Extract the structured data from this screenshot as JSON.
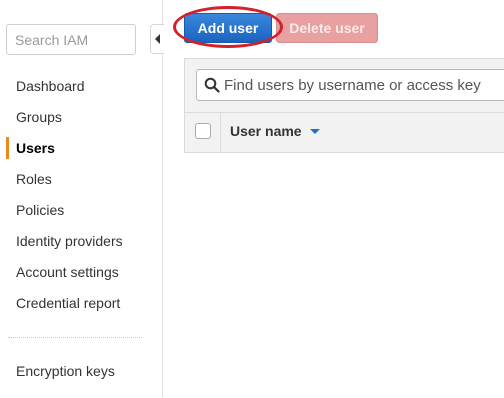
{
  "sidebar": {
    "search_placeholder": "Search IAM",
    "items": [
      {
        "label": "Dashboard",
        "active": false
      },
      {
        "label": "Groups",
        "active": false
      },
      {
        "label": "Users",
        "active": true
      },
      {
        "label": "Roles",
        "active": false
      },
      {
        "label": "Policies",
        "active": false
      },
      {
        "label": "Identity providers",
        "active": false
      },
      {
        "label": "Account settings",
        "active": false
      },
      {
        "label": "Credential report",
        "active": false
      }
    ],
    "secondary_items": [
      {
        "label": "Encryption keys"
      }
    ]
  },
  "toolbar": {
    "add_user_label": "Add user",
    "delete_user_label": "Delete user"
  },
  "users_table": {
    "filter_placeholder": "Find users by username or access key",
    "columns": [
      {
        "label": "User name",
        "sort": "descending"
      }
    ]
  },
  "colors": {
    "primary_button": "#1a64c0",
    "disabled_danger_button": "#e8a0a0",
    "active_nav_marker": "#e88d1c",
    "highlight_annotation": "#d3212c"
  }
}
